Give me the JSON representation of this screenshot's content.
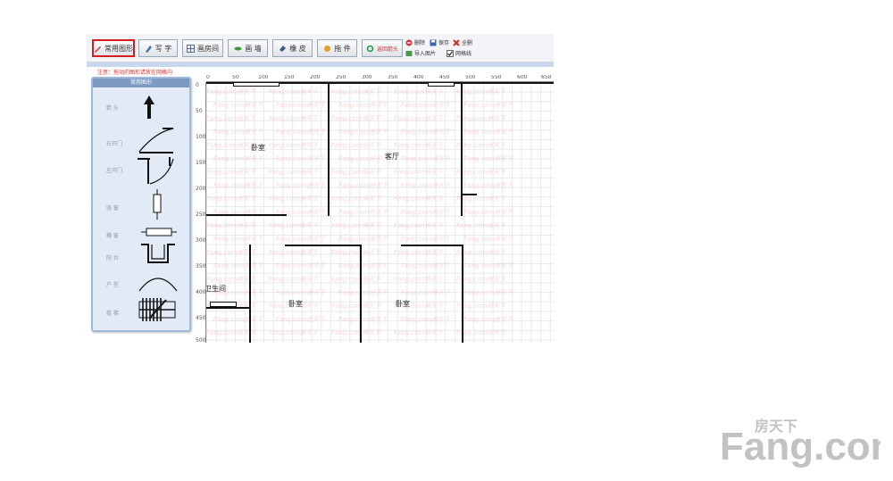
{
  "toolbar": {
    "common_shapes": "常用图形",
    "write_text": "写 字",
    "draw_room": "画房间",
    "draw_wall": "画 墙",
    "eraser": "橡 皮",
    "drag": "拖 件",
    "back_arrow": "返回箭头",
    "delete": "删除",
    "save": "保存",
    "clear_all": "全删",
    "import_image": "导入图片",
    "grid_line": "网格线"
  },
  "notice": "注意：拖动的图形请放在网格内",
  "palette": {
    "title": "常用图形",
    "items": [
      "箭 头",
      "右开门",
      "左开门",
      "竖 窗",
      "横 窗",
      "阳 台",
      "户 型",
      "楼 梯"
    ]
  },
  "ruler": {
    "h": [
      "0",
      "50",
      "100",
      "150",
      "200",
      "250",
      "300",
      "350",
      "400",
      "450",
      "500",
      "550",
      "600",
      "650"
    ],
    "v": [
      "0",
      "50",
      "100",
      "150",
      "200",
      "250",
      "300",
      "350",
      "400",
      "450",
      "500"
    ]
  },
  "rooms": {
    "bedroom1": "卧室",
    "living": "客厅",
    "bathroom": "卫生间",
    "bedroom2": "卧室",
    "bedroom3": "卧室"
  },
  "watermark": "Fang.com房天下",
  "logo": {
    "brand": "Fang.com",
    "cn": "房天下"
  },
  "colors": {
    "accent_red": "#d51d1d",
    "palette_header": "#7d9ac5",
    "logo_gray": "#bfbfbf"
  }
}
